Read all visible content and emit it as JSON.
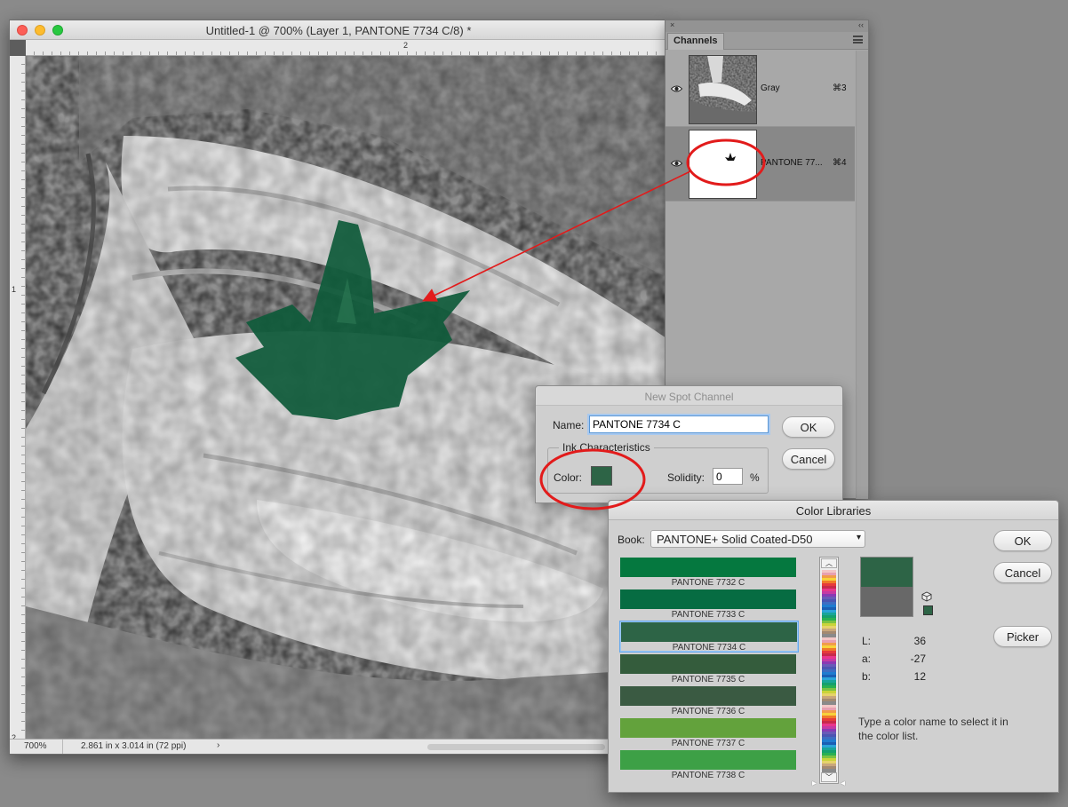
{
  "document": {
    "title": "Untitled-1 @ 700% (Layer 1, PANTONE 7734 C/8) *",
    "ruler_h_label": "2",
    "ruler_v_labels": [
      "1",
      "2"
    ],
    "zoom": "700%",
    "info": "2.861 in x 3.014 in (72 ppi)",
    "status_arrow": "›",
    "spot_color": "#0f5a3a"
  },
  "channels_panel": {
    "close_glyph": "×",
    "collapse_glyph": "‹‹",
    "tab_label": "Channels",
    "channels": [
      {
        "name": "Gray",
        "shortcut": "⌘3"
      },
      {
        "name": "PANTONE 77...",
        "shortcut": "⌘4"
      }
    ]
  },
  "spot_dialog": {
    "title": "New Spot Channel",
    "name_label": "Name:",
    "name_value": "PANTONE 7734 C",
    "ink_group_label": "Ink Characteristics",
    "color_label": "Color:",
    "ink_color": "#2d6446",
    "solidity_label": "Solidity:",
    "solidity_value": "0",
    "percent": "%",
    "ok": "OK",
    "cancel": "Cancel"
  },
  "color_libraries": {
    "title": "Color Libraries",
    "book_label": "Book:",
    "book_value": "PANTONE+ Solid Coated-D50",
    "swatches": [
      {
        "name": "PANTONE 7732 C",
        "color": "#05783f"
      },
      {
        "name": "PANTONE 7733 C",
        "color": "#066c42"
      },
      {
        "name": "PANTONE 7734 C",
        "color": "#2d6446"
      },
      {
        "name": "PANTONE 7735 C",
        "color": "#345c3c"
      },
      {
        "name": "PANTONE 7736 C",
        "color": "#3a5a42"
      },
      {
        "name": "PANTONE 7737 C",
        "color": "#63a23c"
      },
      {
        "name": "PANTONE 7738 C",
        "color": "#3da046"
      }
    ],
    "selected_index": 2,
    "preview_new": "#2d6446",
    "preview_old": "#686868",
    "lab": [
      {
        "label": "L:",
        "value": "36"
      },
      {
        "label": "a:",
        "value": "-27"
      },
      {
        "label": "b:",
        "value": "12"
      }
    ],
    "hint": "Type a color name to select it in the color list.",
    "ok": "OK",
    "cancel": "Cancel",
    "picker": "Picker"
  },
  "annotation_color": "#e21b1b"
}
